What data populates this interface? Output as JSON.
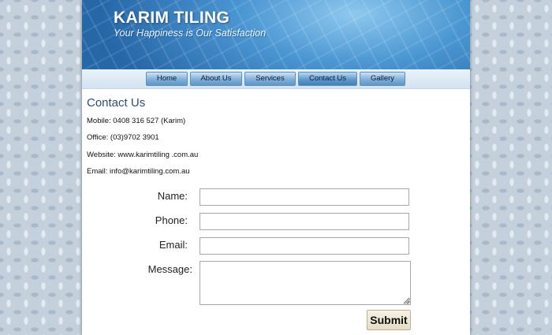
{
  "header": {
    "site_title": "KARIM TILING",
    "tagline": "Your Happiness is Our Satisfaction"
  },
  "nav": {
    "items": [
      {
        "label": "Home"
      },
      {
        "label": "About Us"
      },
      {
        "label": "Services"
      },
      {
        "label": "Contact Us",
        "active": true
      },
      {
        "label": "Gallery"
      }
    ]
  },
  "contact": {
    "heading": "Contact Us",
    "mobile": "Mobile: 0408 316 527 (Karim)",
    "office": "Office: (03)9702 3901",
    "website": "Website: www.karimtiling .com.au",
    "email": "Email: info@karimtiling.com.au"
  },
  "form": {
    "name_label": "Name:",
    "name_value": "",
    "phone_label": "Phone:",
    "phone_value": "",
    "email_label": "Email:",
    "email_value": "",
    "message_label": "Message:",
    "message_value": "",
    "submit_label": "Submit"
  }
}
